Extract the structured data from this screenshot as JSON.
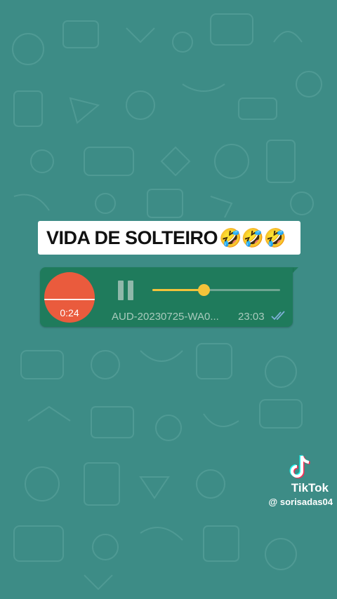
{
  "caption": {
    "text": "VIDA DE SOLTEIRO",
    "emoji": "🤣🤣🤣"
  },
  "voice_message": {
    "elapsed": "0:24",
    "filename": "AUD-20230725-WA0...",
    "time": "23:03",
    "progress": 0.4,
    "status_icon": "double-check-read-icon",
    "control_icon": "pause-icon"
  },
  "watermark": {
    "brand": "TikTok",
    "username": "@ sorisadas04"
  },
  "colors": {
    "background": "#3d8c86",
    "bubble": "#1f7b5c",
    "avatar": "#ea5b3d",
    "progress": "#f3c33a",
    "read_checks": "#7fb0d9"
  }
}
